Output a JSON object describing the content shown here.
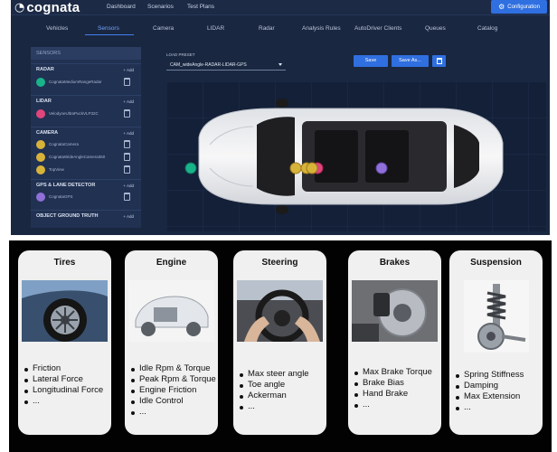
{
  "app": {
    "logo": "cognata",
    "nav": [
      "Dashboard",
      "Scenarios",
      "Test Plans"
    ],
    "config_label": "Configuration",
    "tabs": [
      {
        "label": "Vehicles"
      },
      {
        "label": "Sensors",
        "active": true
      },
      {
        "label": "Camera"
      },
      {
        "label": "LIDAR"
      },
      {
        "label": "Radar"
      },
      {
        "label": "Analysis Rules"
      },
      {
        "label": "AutoDriver Clients"
      },
      {
        "label": "Queues"
      },
      {
        "label": "Catalog"
      }
    ],
    "sidebar": {
      "header": "SENSORS",
      "add_label": "+ Add",
      "sections": [
        {
          "title": "RADAR",
          "items": [
            {
              "label": "CognataMediumRangeRadar",
              "color": "#19b38a"
            }
          ]
        },
        {
          "title": "LIDAR",
          "items": [
            {
              "label": "VelodyneUltraPuckVLP32C",
              "color": "#e0457b"
            }
          ]
        },
        {
          "title": "CAMERA",
          "items": [
            {
              "label": "CognataCamera",
              "color": "#d8b33a"
            },
            {
              "label": "CognataWideAngleCamera360",
              "color": "#d8b33a"
            },
            {
              "label": "TopView",
              "color": "#d8b33a"
            }
          ]
        },
        {
          "title": "GPS & LANE DETECTOR",
          "items": [
            {
              "label": "CognataGPS",
              "color": "#8f6fd8"
            }
          ]
        },
        {
          "title": "OBJECT GROUND TRUTH",
          "items": []
        }
      ]
    },
    "load_preset": {
      "label": "LOAD PRESET",
      "value": "CAM_wideAngle-RADAR-LIDAR-GPS"
    },
    "buttons": {
      "save": "Save",
      "save_as": "Save As..."
    }
  },
  "cards": [
    {
      "title": "Tires",
      "items": [
        "Friction",
        "Lateral Force",
        "Longitudinal Force",
        "..."
      ]
    },
    {
      "title": "Engine",
      "items": [
        "Idle Rpm & Torque",
        "Peak Rpm & Torque",
        "Engine Friction",
        "Idle Control",
        "..."
      ]
    },
    {
      "title": "Steering",
      "items": [
        "Max steer angle",
        "Toe angle",
        "Ackerman",
        "..."
      ]
    },
    {
      "title": "Brakes",
      "items": [
        "Max Brake Torque",
        "Brake Bias",
        "Hand Brake",
        "..."
      ]
    },
    {
      "title": "Suspension",
      "items": [
        "Spring Stiffness",
        "Damping",
        "Max Extension",
        "..."
      ]
    }
  ]
}
